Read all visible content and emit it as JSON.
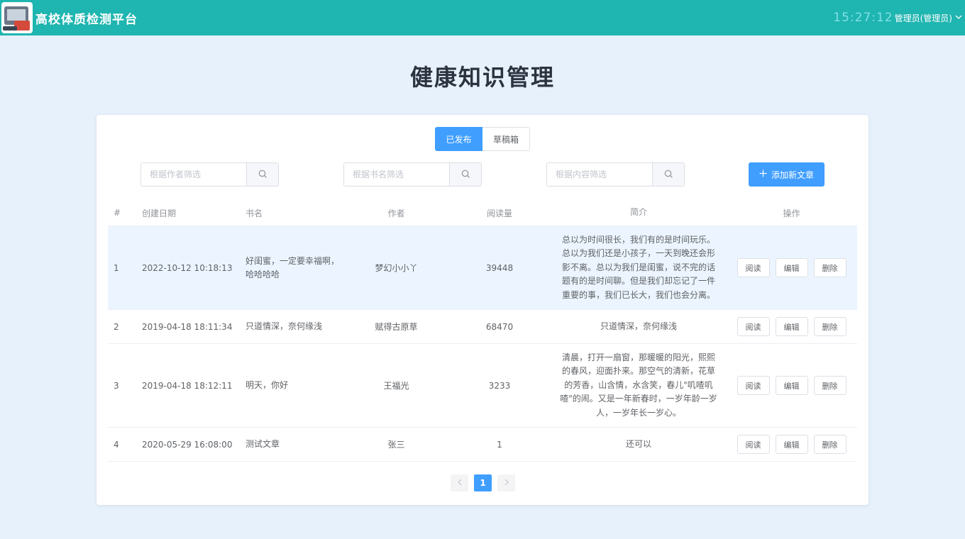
{
  "header": {
    "app_title": "高校体质检测平台",
    "clock": "15:27:12",
    "user": "管理员(管理员)",
    "colors": {
      "bar": "#1fb5b0",
      "clock": "#7fe1e6"
    }
  },
  "page": {
    "title": "健康知识管理"
  },
  "tabs": [
    {
      "label": "已发布",
      "active": true
    },
    {
      "label": "草稿箱",
      "active": false
    }
  ],
  "filters": {
    "author_placeholder": "根据作者筛选",
    "title_placeholder": "根据书名筛选",
    "content_placeholder": "根据内容筛选"
  },
  "add_button": {
    "label": "添加新文章",
    "icon": "plus-icon"
  },
  "table": {
    "columns": [
      "#",
      "创建日期",
      "书名",
      "作者",
      "阅读量",
      "简介",
      "操作"
    ],
    "rows": [
      {
        "idx": "1",
        "date": "2022-10-12 10:18:13",
        "title": "好闺蜜，一定要幸福啊，哈哈哈哈",
        "author": "梦幻小小丫",
        "reads": "39448",
        "intro": "总以为时间很长，我们有的是时间玩乐。总以为我们还是小孩子，一天到晚还会形影不离。总以为我们是闺蜜，说不完的话题有的是时间聊。但是我们却忘记了一件重要的事，我们已长大，我们也会分离。"
      },
      {
        "idx": "2",
        "date": "2019-04-18 18:11:34",
        "title": "只道情深，奈何缘浅",
        "author": "赋得古原草",
        "reads": "68470",
        "intro": "只道情深，奈何缘浅"
      },
      {
        "idx": "3",
        "date": "2019-04-18 18:12:11",
        "title": "明天，你好",
        "author": "王福光",
        "reads": "3233",
        "intro": "清晨，打开一扇窗，那暖暖的阳光，熙熙的春风，迎面扑来。那空气的清新，花草的芳香，山含情，水含笑，春儿\"叽喳叽喳\"的闹。又是一年新春时，一岁年龄一岁人，一岁年长一岁心。"
      },
      {
        "idx": "4",
        "date": "2020-05-29 16:08:00",
        "title": "测试文章",
        "author": "张三",
        "reads": "1",
        "intro": "还可以"
      }
    ],
    "actions": {
      "read": "阅读",
      "edit": "编辑",
      "delete": "删除"
    }
  },
  "pagination": {
    "current": "1",
    "prev_icon": "chevron-left-icon",
    "next_icon": "chevron-right-icon"
  }
}
